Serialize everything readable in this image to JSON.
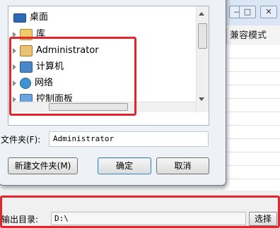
{
  "background_window": {
    "window_buttons": [
      "—",
      "□",
      "✕"
    ],
    "compat_mode_label": "兼容模式"
  },
  "folder_tree": {
    "items": [
      {
        "label": "桌面",
        "icon": "desktop-icon"
      },
      {
        "label": "库",
        "icon": "library-icon"
      },
      {
        "label": "Administrator",
        "icon": "user-folder-icon"
      },
      {
        "label": "计算机",
        "icon": "computer-icon"
      },
      {
        "label": "网络",
        "icon": "network-icon"
      },
      {
        "label": "控制面板",
        "icon": "control-panel-icon"
      }
    ]
  },
  "folder_field": {
    "label": "文件夹(F):",
    "value": "Administrator"
  },
  "buttons": {
    "new_folder": "新建文件夹(M)",
    "ok": "确定",
    "cancel": "取消"
  },
  "output_bar": {
    "label": "输出目录:",
    "value": "D:\\",
    "choose": "选择"
  },
  "colors": {
    "highlight": "#e3262d",
    "dialog_bg": "#eef1f5"
  }
}
